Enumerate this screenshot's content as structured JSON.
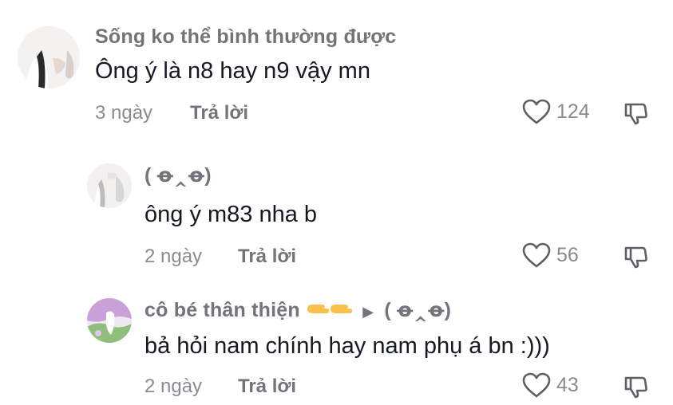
{
  "comments": [
    {
      "username": "Sống ko thể bình thường được",
      "text": "Ông ý là n8 hay n9 vậy mn",
      "time": "3 ngày",
      "reply_label": "Trả lời",
      "likes": "124"
    },
    {
      "username": "( ꝋ‸ꝋ)",
      "text": "ông ý m83 nha b",
      "time": "2 ngày",
      "reply_label": "Trả lời",
      "likes": "56"
    },
    {
      "username": "cô bé thân thiện",
      "reply_to": "( ꝋ‸ꝋ)",
      "text": "bả hỏi nam chính hay nam phụ á bn :)))",
      "time": "2 ngày",
      "reply_label": "Trả lời",
      "likes": "43"
    }
  ],
  "icons": {
    "like": "heart-outline-icon",
    "dislike": "thumbs-down-icon",
    "reply_arrow": "right-triangle-icon",
    "emoji": "pointing-hands-emoji"
  },
  "colors": {
    "username": "#73747b",
    "text": "#161823",
    "meta": "#8a8b91"
  }
}
